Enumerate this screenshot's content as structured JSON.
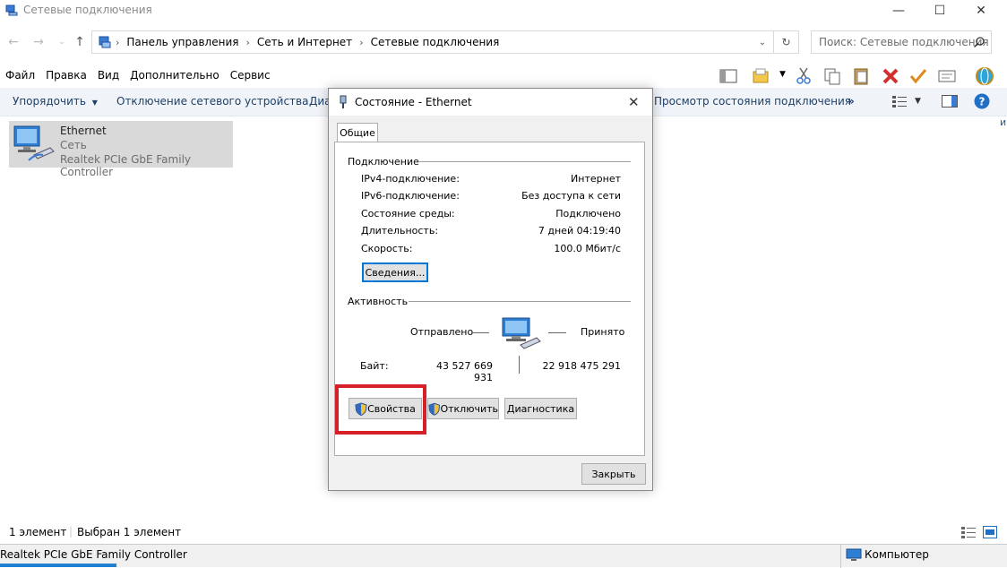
{
  "window": {
    "title": "Сетевые подключения"
  },
  "address": {
    "crumbs": [
      "Панель управления",
      "Сеть и Интернет",
      "Сетевые подключения"
    ]
  },
  "search": {
    "placeholder": "Поиск: Сетевые подключения"
  },
  "menu": {
    "items": [
      "Файл",
      "Правка",
      "Вид",
      "Дополнительно",
      "Сервис"
    ]
  },
  "commandbar": {
    "organize": "Упорядочить",
    "disable": "Отключение сетевого устройства",
    "diag_partial": "Диа",
    "view_status": "Просмотр состояния подключения",
    "more": "»"
  },
  "item": {
    "name": "Ethernet",
    "network": "Сеть",
    "adapter": "Realtek PCIe GbE Family Controller"
  },
  "status": {
    "count": "1 элемент",
    "selected": "Выбран 1 элемент",
    "bottom_left": "Realtek PCIe GbE Family Controller",
    "bottom_right": "Компьютер"
  },
  "dialog": {
    "title": "Состояние - Ethernet",
    "tab": "Общие",
    "connection": {
      "heading": "Подключение",
      "rows": [
        {
          "label": "IPv4-подключение:",
          "value": "Интернет"
        },
        {
          "label": "IPv6-подключение:",
          "value": "Без доступа к сети"
        },
        {
          "label": "Состояние среды:",
          "value": "Подключено"
        },
        {
          "label": "Длительность:",
          "value": "7 дней 04:19:40"
        },
        {
          "label": "Скорость:",
          "value": "100.0 Мбит/с"
        }
      ],
      "details_button": "Сведения..."
    },
    "activity": {
      "heading": "Активность",
      "sent_label": "Отправлено",
      "received_label": "Принято",
      "bytes_label": "Байт:",
      "bytes_sent": "43 527 669 931",
      "bytes_received": "22 918 475 291"
    },
    "buttons": {
      "properties": "Свойства",
      "disable": "Отключить",
      "diagnose": "Диагностика",
      "close": "Закрыть"
    }
  },
  "colors": {
    "highlight": "#d62027",
    "accent": "#0078d7",
    "commandbar_bg": "#f0f4f9"
  }
}
